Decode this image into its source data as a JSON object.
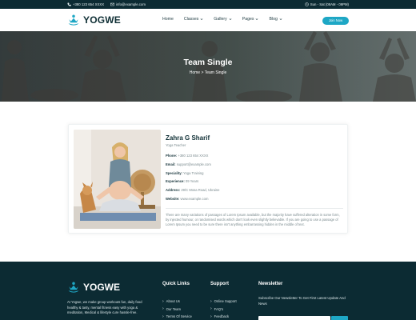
{
  "topbar": {
    "phone": "+380 123 654 XXXX",
    "email": "info@example.com",
    "hours": "Sun - Sat (08AM - 09PM)",
    "icons": [
      "phone-icon",
      "mail-icon",
      "clock-icon"
    ]
  },
  "header": {
    "logo_text": "YOGWE",
    "nav": [
      {
        "label": "Home"
      },
      {
        "label": "Classes"
      },
      {
        "label": "Gallery"
      },
      {
        "label": "Pages"
      },
      {
        "label": "Blog"
      }
    ],
    "join_label": "Join Now"
  },
  "hero": {
    "title": "Team Single",
    "breadcrumb_home": "Home",
    "breadcrumb_sep": ">",
    "breadcrumb_current": "Team Single"
  },
  "profile": {
    "name": "Zahra G Sharif",
    "role": "Yoga Teacher",
    "details": [
      {
        "label": "Phone:",
        "value": "+380 123 654 XXXX"
      },
      {
        "label": "Email:",
        "value": "support@example.com"
      },
      {
        "label": "Speciality:",
        "value": "Yoga Training"
      },
      {
        "label": "Experience:",
        "value": "09 Years"
      },
      {
        "label": "Address:",
        "value": "29/C Mosa Road, Ukraine"
      },
      {
        "label": "Website:",
        "value": "www.example.com"
      }
    ],
    "description": "There are many variations of passages of Lorem Ipsum available, but the majority have suffered alteration in some form, by injected humour, or randomised words which don't look even slightly believable. If you are going to use a passage of Lorem Ipsum you need to be sure there isn't anything embarrassing hidden in the middle of text."
  },
  "footer": {
    "logo_text": "YOGWE",
    "about": "At Yogwe, we make group workouts fun, daily food healthy & tasty, mental fitness easy with yoga & meditation, Medical & lifestyle cure hassle-free.",
    "quick_links_title": "Quick Links",
    "quick_links": [
      "About Us",
      "Our Team",
      "Terms Of Service"
    ],
    "support_title": "Support",
    "support_links": [
      "Online Support",
      "FAQ's",
      "Feedback"
    ],
    "newsletter_title": "Newsletter",
    "newsletter_text": "Subscribe Our Newsletter To Get First Latest Update And News"
  },
  "colors": {
    "accent": "#1ea7c5",
    "dark": "#0c2b33"
  }
}
